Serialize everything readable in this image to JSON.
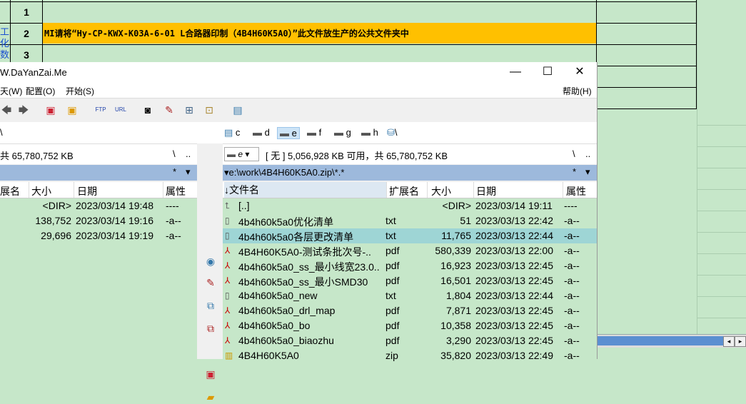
{
  "spreadsheet": {
    "rows": [
      {
        "num": "1",
        "text": ""
      },
      {
        "num": "2",
        "text": "MI请将“Hy-CP-KWX-K03A-6-01 L合路器印制（4B4H60K5A0）”此文件放生产的公共文件夹中"
      },
      {
        "num": "3",
        "text": ""
      }
    ],
    "side_chars": [
      "工",
      "化",
      "数"
    ],
    "highlight_color": "#ffc000"
  },
  "window": {
    "title": "W.DaYanZai.Me",
    "minimize": "—",
    "maximize": "☐",
    "close": "✕",
    "menu": {
      "items": [
        "天(W)",
        "配置(O)",
        "开始(S)"
      ],
      "help": "帮助(H)"
    },
    "toolbar_icons": [
      "back-icon",
      "forward-icon",
      "pack-icon",
      "unpack-icon",
      "ftp-icon",
      "url-icon",
      "binoculars-icon",
      "rename-icon",
      "sync-icon",
      "compare-icon",
      "notepad-icon"
    ],
    "left_panel": {
      "drive_path": "\\",
      "free_space": "共 65,780,752 KB",
      "nav": [
        "\\",
        ".."
      ],
      "filter": "*",
      "headers": [
        "展名",
        "大小",
        "日期",
        "属性"
      ],
      "rows": [
        {
          "size": "<DIR>",
          "date": "2023/03/14 19:48",
          "attr": "----"
        },
        {
          "size": "138,752",
          "date": "2023/03/14 19:16",
          "attr": "-a--"
        },
        {
          "size": "29,696",
          "date": "2023/03/14 19:19",
          "attr": "-a--"
        }
      ]
    },
    "drives": [
      "c",
      "d",
      "e",
      "f",
      "g",
      "h",
      "\\"
    ],
    "active_drive": "e",
    "right_panel": {
      "drive": "e",
      "free_space": "[ 无 ]  5,056,928 KB 可用，共 65,780,752 KB",
      "nav": [
        "\\",
        ".."
      ],
      "path": "e:\\work\\4B4H60K5A0.zip\\*.*",
      "filter": "*",
      "headers": [
        "↓文件名",
        "扩展名",
        "大小",
        "日期",
        "属性"
      ],
      "rows": [
        {
          "name": "[..]",
          "ext": "",
          "size": "<DIR>",
          "date": "2023/03/14 19:11",
          "attr": "----",
          "icon": "up-folder-icon"
        },
        {
          "name": "4b4h60k5a0优化清单",
          "ext": "txt",
          "size": "51",
          "date": "2023/03/13 22:42",
          "attr": "-a--",
          "icon": "text-file-icon"
        },
        {
          "name": "4b4h60k5a0各层更改清单",
          "ext": "txt",
          "size": "11,765",
          "date": "2023/03/13 22:44",
          "attr": "-a--",
          "icon": "text-file-icon",
          "selected": true
        },
        {
          "name": "4B4H60K5A0-测试条批次号-..",
          "ext": "pdf",
          "size": "580,339",
          "date": "2023/03/13 22:00",
          "attr": "-a--",
          "icon": "pdf-file-icon"
        },
        {
          "name": "4b4h60k5a0_ss_最小线宽23.0..",
          "ext": "pdf",
          "size": "16,923",
          "date": "2023/03/13 22:45",
          "attr": "-a--",
          "icon": "pdf-file-icon"
        },
        {
          "name": "4b4h60k5a0_ss_最小SMD30",
          "ext": "pdf",
          "size": "16,501",
          "date": "2023/03/13 22:45",
          "attr": "-a--",
          "icon": "pdf-file-icon"
        },
        {
          "name": "4b4h60k5a0_new",
          "ext": "txt",
          "size": "1,804",
          "date": "2023/03/13 22:44",
          "attr": "-a--",
          "icon": "text-file-icon"
        },
        {
          "name": "4b4h60k5a0_drl_map",
          "ext": "pdf",
          "size": "7,871",
          "date": "2023/03/13 22:45",
          "attr": "-a--",
          "icon": "pdf-file-icon"
        },
        {
          "name": "4b4h60k5a0_bo",
          "ext": "pdf",
          "size": "10,358",
          "date": "2023/03/13 22:45",
          "attr": "-a--",
          "icon": "pdf-file-icon"
        },
        {
          "name": "4b4h60k5a0_biaozhu",
          "ext": "pdf",
          "size": "3,290",
          "date": "2023/03/13 22:45",
          "attr": "-a--",
          "icon": "pdf-file-icon"
        },
        {
          "name": "4B4H60K5A0",
          "ext": "zip",
          "size": "35,820",
          "date": "2023/03/13 22:49",
          "attr": "-a--",
          "icon": "zip-file-icon"
        }
      ]
    }
  }
}
